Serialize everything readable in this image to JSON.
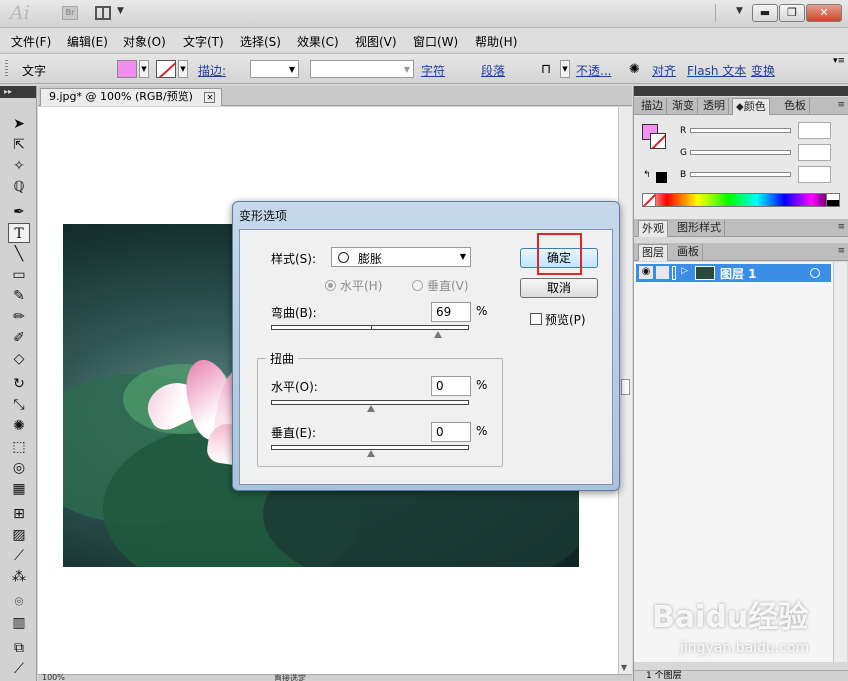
{
  "app": {
    "logo": "Ai",
    "bridge_badge": "Br",
    "window_buttons": {
      "minimize": "▬",
      "restore": "❐",
      "close": "✕"
    }
  },
  "menubar": {
    "items": [
      "文件(F)",
      "编辑(E)",
      "对象(O)",
      "文字(T)",
      "选择(S)",
      "效果(C)",
      "视图(V)",
      "窗口(W)",
      "帮助(H)"
    ]
  },
  "controlbar": {
    "tool_name": "文字",
    "stroke_label": "描边:",
    "char_label": "字符",
    "para_label": "段落",
    "opacity_label": "不透...",
    "align_label": "对齐",
    "flash_label": "Flash 文本",
    "transform_label": "变换",
    "fill_color": "#f38ff0"
  },
  "document": {
    "tab_title": "9.jpg* @ 100% (RGB/预览)",
    "zoom": "100%",
    "status_text": "直接选定"
  },
  "dialog": {
    "title": "变形选项",
    "style_label": "样式(S):",
    "style_value": "膨胀",
    "horizontal_radio": "水平(H)",
    "vertical_radio": "垂直(V)",
    "bend_label": "弯曲(B):",
    "bend_value": "69",
    "bend_level": 0.69,
    "distort_group": "扭曲",
    "distort_h_label": "水平(O):",
    "distort_h_value": "0",
    "distort_v_label": "垂直(E):",
    "distort_v_value": "0",
    "percent": "%",
    "ok_button": "确定",
    "cancel_button": "取消",
    "preview_label": "预览(P)"
  },
  "panels": {
    "top_tabs": [
      "描边",
      "渐变",
      "透明",
      "颜色",
      "色板"
    ],
    "channels": [
      "R",
      "G",
      "B"
    ],
    "mid_tabs": [
      "外观",
      "图形样式"
    ],
    "bottom_tabs": [
      "图层",
      "画板"
    ],
    "layer_name": "图层 1",
    "layer_count": "1 个图层"
  },
  "watermark": {
    "brand": "Baidu经验",
    "url": "jingyan.baidu.com"
  },
  "accent": {
    "highlight": "#e0262a",
    "selection": "#3a8ee6"
  }
}
